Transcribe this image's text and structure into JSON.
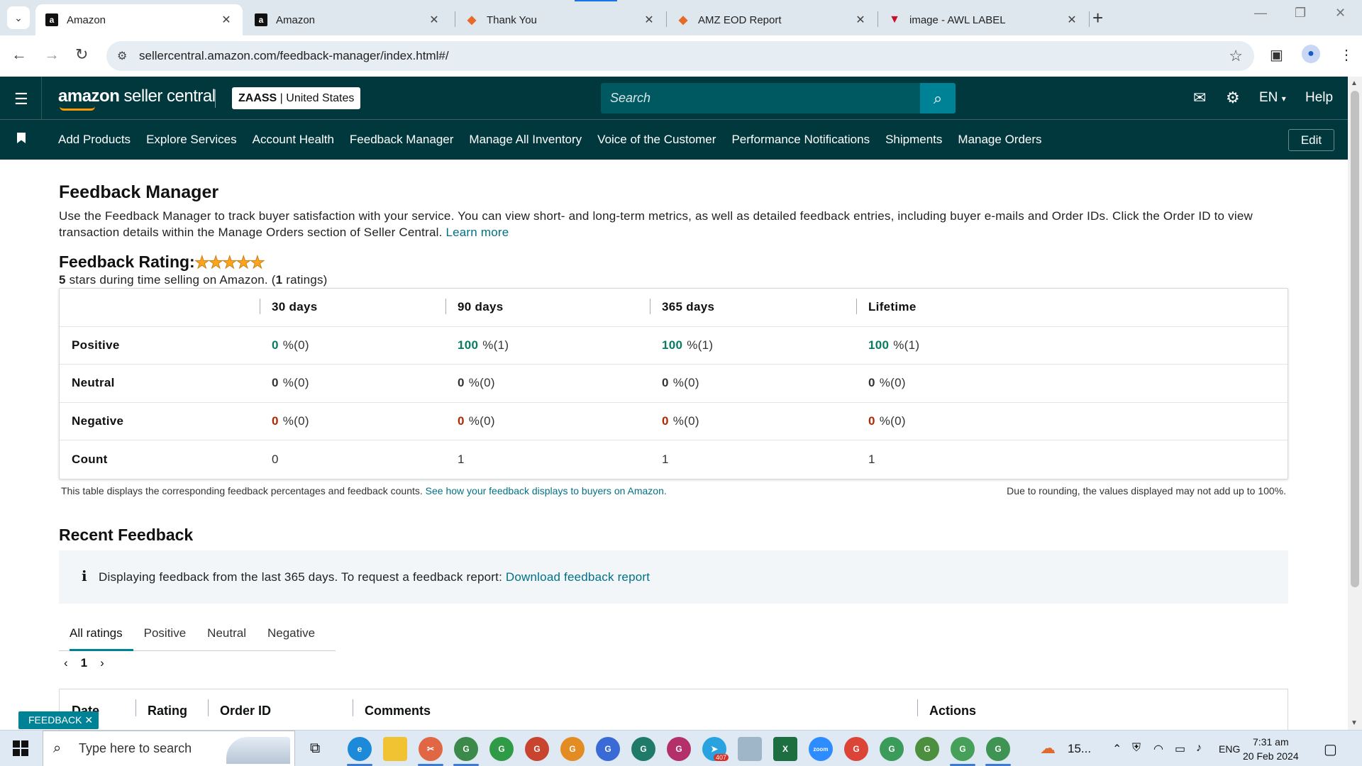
{
  "browser": {
    "tabs": [
      {
        "title": "Amazon",
        "favicon": "amazon-icon",
        "active": true
      },
      {
        "title": "Amazon",
        "favicon": "amazon-icon",
        "active": false
      },
      {
        "title": "Thank You",
        "favicon": "clickup-icon",
        "active": false
      },
      {
        "title": "AMZ EOD Report",
        "favicon": "clickup-icon",
        "active": false
      },
      {
        "title": "image - AWL LABEL",
        "favicon": "awl-icon",
        "active": false
      }
    ],
    "url": "sellercentral.amazon.com/feedback-manager/index.html#/"
  },
  "header": {
    "logo_brand": "amazon",
    "logo_suffix": " seller central",
    "store_name": "ZAASS",
    "store_region": " | United States",
    "search_placeholder": "Search",
    "language": "EN",
    "help": "Help"
  },
  "nav": {
    "links": [
      "Add Products",
      "Explore Services",
      "Account Health",
      "Feedback Manager",
      "Manage All Inventory",
      "Voice of the Customer",
      "Performance Notifications",
      "Shipments",
      "Manage Orders"
    ],
    "edit": "Edit"
  },
  "page": {
    "title": "Feedback Manager",
    "intro": "Use the Feedback Manager to track buyer satisfaction with your service. You can view short- and long-term metrics, as well as detailed feedback entries, including buyer e-mails and Order IDs. Click the Order ID to view transaction details within the Manage Orders section of Seller Central. ",
    "learn_more": "Learn more",
    "rating_title": "Feedback Rating:",
    "rating_stars": 5,
    "rating_stars_glyph": "★★★★★",
    "rating_value": "5",
    "rating_sub_mid": " stars during time selling on Amazon. (",
    "rating_count": "1",
    "rating_sub_end": " ratings)"
  },
  "feedback_table": {
    "columns": [
      "30 days",
      "90 days",
      "365 days",
      "Lifetime"
    ],
    "rows": [
      {
        "label": "Positive",
        "values": [
          [
            "0",
            " %(0)"
          ],
          [
            "100",
            " %(1)"
          ],
          [
            "100",
            " %(1)"
          ],
          [
            "100",
            " %(1)"
          ]
        ]
      },
      {
        "label": "Neutral",
        "values": [
          [
            "0",
            " %(0)"
          ],
          [
            "0",
            " %(0)"
          ],
          [
            "0",
            " %(0)"
          ],
          [
            "0",
            " %(0)"
          ]
        ]
      },
      {
        "label": "Negative",
        "values": [
          [
            "0",
            " %(0)"
          ],
          [
            "0",
            " %(0)"
          ],
          [
            "0",
            " %(0)"
          ],
          [
            "0",
            " %(0)"
          ]
        ]
      },
      {
        "label": "Count",
        "values": [
          [
            "0",
            ""
          ],
          [
            "1",
            ""
          ],
          [
            "1",
            ""
          ],
          [
            "1",
            ""
          ]
        ]
      }
    ],
    "note": "This table displays the corresponding feedback percentages and feedback counts. ",
    "note_link": "See how your feedback displays to buyers on Amazon.",
    "rounding_note": "Due to rounding, the values displayed may not add up to 100%."
  },
  "recent": {
    "title": "Recent Feedback",
    "info_text": "Displaying feedback from the last 365 days. To request a feedback report: ",
    "info_link": "Download feedback report",
    "tabs": [
      "All ratings",
      "Positive",
      "Neutral",
      "Negative"
    ],
    "page": "1",
    "list_columns": [
      "Date",
      "Rating",
      "Order ID",
      "Comments",
      "Actions"
    ]
  },
  "feedback_button": "FEEDBACK ✕",
  "taskbar": {
    "search_placeholder": "Type here to search",
    "weather": "15...",
    "language": "ENG",
    "time": "7:31 am",
    "date": "20 Feb 2024",
    "telegram_badge": "407"
  },
  "colors": {
    "header_bg": "#00383e",
    "accent": "#008296",
    "positive": "#067d62",
    "negative": "#b12704",
    "link": "#007185",
    "star": "#ffa41c"
  }
}
